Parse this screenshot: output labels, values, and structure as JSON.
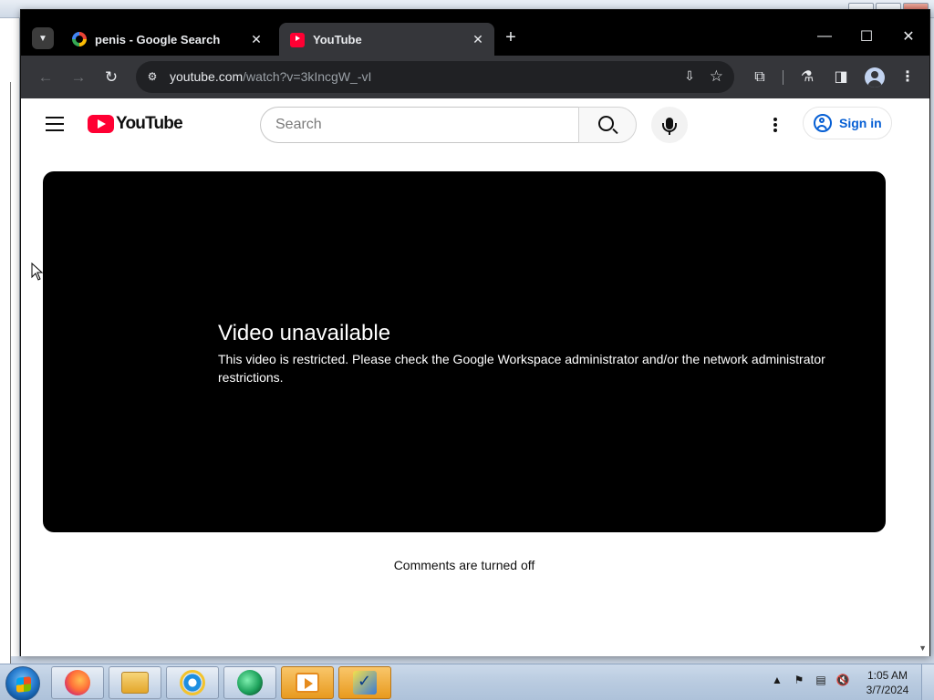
{
  "desktop": {
    "background_color": "#cfd8e4"
  },
  "browser": {
    "tabs": [
      {
        "title": "penis - Google Search",
        "favicon": "google-icon",
        "active": false
      },
      {
        "title": "YouTube",
        "favicon": "youtube-icon",
        "active": true
      }
    ],
    "new_tab_symbol": "+",
    "window_controls": {
      "minimize": "—",
      "maximize": "☐",
      "close": "✕"
    },
    "address_bar": {
      "host": "youtube.com",
      "path": "/watch?v=3kIncgW_-vI"
    },
    "toolbar_icons": [
      "back-icon",
      "forward-icon",
      "reload-icon",
      "site-info-icon",
      "install-app-icon",
      "bookmark-star-icon",
      "extensions-icon",
      "labs-flask-icon",
      "side-panel-icon",
      "profile-avatar-icon",
      "menu-kebab-icon"
    ]
  },
  "youtube": {
    "logo_text": "YouTube",
    "search": {
      "placeholder": "Search"
    },
    "sign_in_label": "Sign in",
    "player": {
      "title": "Video unavailable",
      "message": "This video is restricted. Please check the Google Workspace administrator and/or the network administrator restrictions."
    },
    "comments_status": "Comments are turned off",
    "colors": {
      "brand_red": "#ff0033",
      "link_blue": "#065fd4"
    }
  },
  "taskbar": {
    "apps": [
      "firefox-icon",
      "file-explorer-icon",
      "internet-explorer-icon",
      "chat-app-icon",
      "media-player-icon",
      "checklist-app-icon"
    ],
    "tray_icons": [
      "show-hidden-icons",
      "action-center-flag-icon",
      "network-icon",
      "volume-muted-icon"
    ],
    "clock": {
      "time": "1:05 AM",
      "date": "3/7/2024"
    }
  }
}
